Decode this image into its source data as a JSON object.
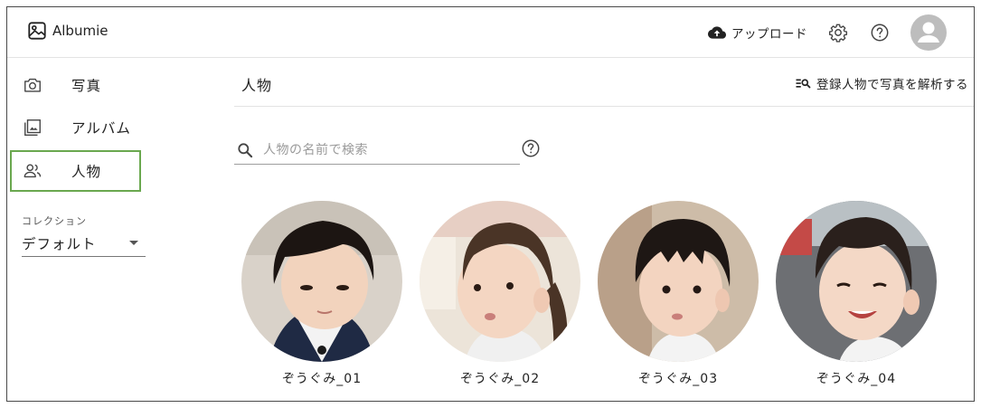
{
  "app": {
    "name": "Albumie"
  },
  "header": {
    "upload_label": "アップロード",
    "settings_icon": "gear-icon",
    "help_icon": "help-icon",
    "avatar_icon": "account-icon"
  },
  "sidebar": {
    "items": [
      {
        "label": "写真",
        "icon": "camera-icon",
        "selected": false
      },
      {
        "label": "アルバム",
        "icon": "photo-album-icon",
        "selected": false
      },
      {
        "label": "人物",
        "icon": "people-icon",
        "selected": true
      }
    ],
    "collection_label": "コレクション",
    "collection_value": "デフォルト"
  },
  "main": {
    "title": "人物",
    "analyze_label": "登録人物で写真を解析する",
    "search": {
      "placeholder": "人物の名前で検索",
      "value": ""
    },
    "people": [
      {
        "name": "ぞうぐみ_01"
      },
      {
        "name": "ぞうぐみ_02"
      },
      {
        "name": "ぞうぐみ_03"
      },
      {
        "name": "ぞうぐみ_04"
      }
    ]
  },
  "colors": {
    "selected_outline": "#6aa84f",
    "divider": "#e3e3e3",
    "avatar_bg": "#bdbdbd"
  }
}
